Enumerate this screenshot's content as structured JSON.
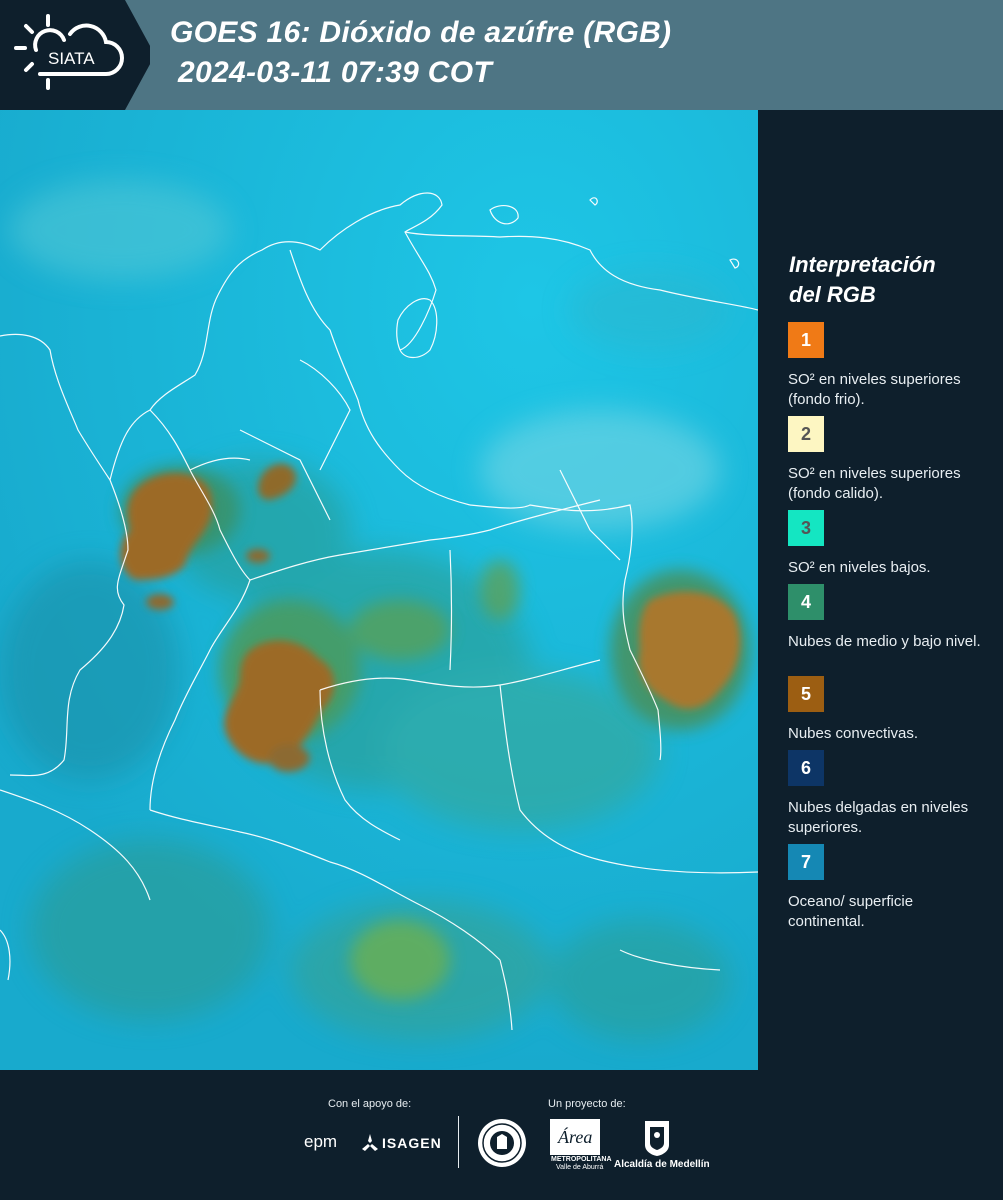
{
  "header": {
    "logo_text": "SIATA",
    "title_line1": "GOES 16: Dióxido de azúfre (RGB)",
    "title_line2": "2024-03-11 07:39 COT"
  },
  "legend": {
    "title_line1": "Interpretación",
    "title_line2": "del RGB",
    "items": [
      {
        "number": "1",
        "color": "#f07a16",
        "text": "SO² en niveles superiores (fondo frio)."
      },
      {
        "number": "2",
        "color": "#fdf6c2",
        "text": "SO² en niveles superiores (fondo calido)."
      },
      {
        "number": "3",
        "color": "#14e6c2",
        "text": "SO² en niveles bajos."
      },
      {
        "number": "4",
        "color": "#2e8f6a",
        "text": "Nubes de medio y bajo nivel."
      },
      {
        "number": "5",
        "color": "#9c5e12",
        "text": "Nubes convectivas."
      },
      {
        "number": "6",
        "color": "#0d3566",
        "text": "Nubes delgadas en niveles superiores."
      },
      {
        "number": "7",
        "color": "#1588b4",
        "text": "Oceano/ superficie continental."
      }
    ]
  },
  "footer": {
    "support_label": "Con el apoyo de:",
    "project_label": "Un proyecto de:",
    "sponsor_epm": "epm",
    "sponsor_isagen": "ISAGEN",
    "partner_area_line1": "METROPOLITANA",
    "partner_area_line2": "Valle de Aburrá",
    "partner_alcaldia": "Alcaldía de Medellín"
  },
  "colors": {
    "header_bg": "#4e7584",
    "panel_bg": "#0e1f2c",
    "ocean_cyan": "#16b7d6",
    "convective_brown": "#9c6a28"
  }
}
